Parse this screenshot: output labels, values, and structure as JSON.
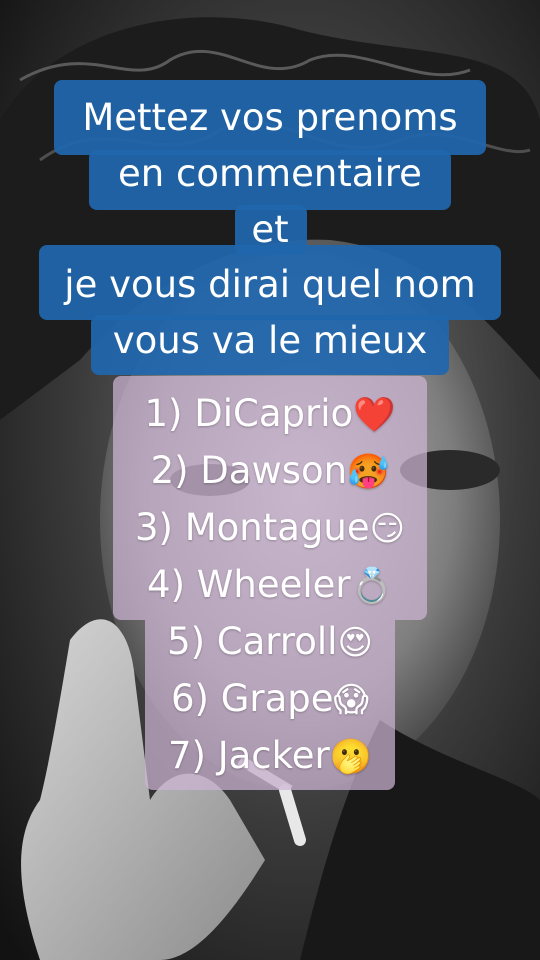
{
  "caption": {
    "lines": [
      "Mettez vos prenoms",
      "en commentaire",
      "et",
      "je vous dirai quel nom",
      "vous va le mieux"
    ]
  },
  "list": [
    {
      "text": "1) DiCaprio",
      "emoji": "❤️"
    },
    {
      "text": "2) Dawson",
      "emoji": "🥵"
    },
    {
      "text": "3) Montague",
      "emoji": "😏"
    },
    {
      "text": "4) Wheeler",
      "emoji": "💍"
    },
    {
      "text": "5) Carroll",
      "emoji": "😍"
    },
    {
      "text": "6) Grape",
      "emoji": "😱"
    },
    {
      "text": "7) Jacker",
      "emoji": "🫢"
    }
  ],
  "colors": {
    "caption_bg": "#1f66ac",
    "list_bg": "#cdb4d2",
    "text": "#ffffff"
  }
}
